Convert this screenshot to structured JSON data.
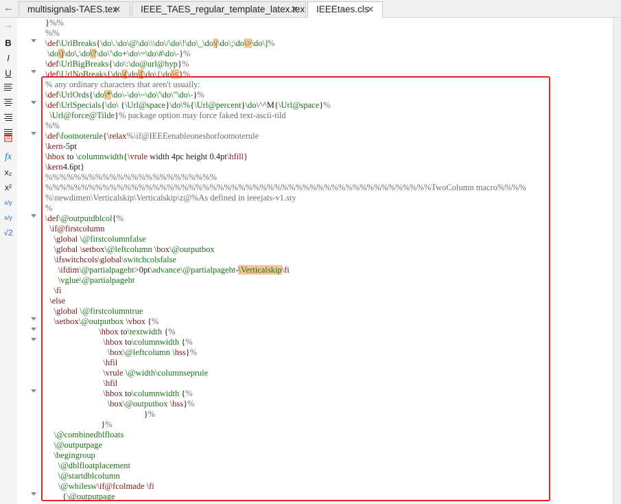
{
  "tabs": [
    {
      "label": "multisignals-TAES.tex",
      "close": "✕"
    },
    {
      "label": "IEEE_TAES_regular_template_latex.tex",
      "close": "✕"
    },
    {
      "label": "IEEEtaes.cls",
      "close": "✕",
      "active": true
    }
  ],
  "nav": {
    "back": "←",
    "forward": "→"
  },
  "toolbar": {
    "bold": "B",
    "italic": "I",
    "underline": "U",
    "fx": "fx",
    "subscript": "x₂",
    "superscript": "x²",
    "fraction": "x/y",
    "inline_fraction": "x/y",
    "sqrt": "√2",
    "icons": [
      "bold-icon",
      "italic-icon",
      "underline-icon",
      "align-left-icon",
      "align-center-icon",
      "align-right-icon",
      "align-justify-icon",
      "insert-image-icon",
      "function-icon",
      "subscript-icon",
      "superscript-icon",
      "fraction-icon",
      "inline-fraction-icon",
      "square-root-icon"
    ]
  },
  "highlight_color": "#f7c59a",
  "selection_color": "#e8201f",
  "editor_lines": [
    "}%%",
    "%%",
    "\\def\\UrlBreaks{\\do\\.\\do\\@\\do\\\\\\do\\/\\do\\!\\do\\_\\do\\|\\do\\;\\do\\>\\do\\]%",
    " \\do\\)\\do\\,\\do\\?\\do\\'\\do+\\do\\=\\do\\#\\do\\-}%",
    "\\def\\UrlBigBreaks{\\do\\:\\do@url@hyp}%",
    "\\def\\UrlNoBreaks{\\do\\(\\do\\[\\do\\{\\do\\<}%",
    "% any ordinary characters that aren't usually:",
    "\\def\\UrlOrds{\\do\\*\\do\\-\\do\\~\\do\\'\\do\\\"\\do\\-}%",
    "\\def\\UrlSpecials{\\do\\ {\\Url@space}\\do\\%{\\Url@percent}\\do\\^^M{\\Url@space}%",
    "  \\Url@force@Tilde}% package option may force faked text-ascii-tild",
    "%%",
    "\\def\\footnoterule{\\relax%\\if@IEEEenableoneshotfootnoterule",
    "\\kern-5pt",
    "\\hbox to \\columnwidth{\\vrule width 4pc height 0.4pt\\hfill}",
    "\\kern4.6pt}",
    "%%%%%%%%%%%%%%%%%%%%%%%%",
    "%%%%%%%%%%%%%%%%%%%%%%%%%%%%%%%%%%%%%%%%%%%%%%%%%%%%%%TwoColumn macro%%%%",
    "%\\newdimen\\Verticalskip\\Verticalskip\\z@%As defined in ieeejats-v1.sty",
    "%",
    "\\def\\@outputdblcol{%",
    "  \\if@firstcolumn",
    "    \\global \\@firstcolumnfalse",
    "    \\global \\setbox\\@leftcolumn \\box\\@outputbox",
    "    \\ifswitchcols\\global\\switchcolsfalse",
    "      \\ifdim\\@partialpageht>0pt\\advance\\@partialpageht-\\Verticalskip\\fi",
    "      \\vglue\\@partialpageht",
    "    \\fi",
    "  \\else",
    "    \\global \\@firstcolumntrue",
    "    \\setbox\\@outputbox \\vbox {%",
    "                         \\hbox to\\textwidth {%",
    "                           \\hbox to\\columnwidth {%",
    "                             \\box\\@leftcolumn \\hss}%",
    "                           \\hfil",
    "                           \\vrule \\@width\\columnseprule",
    "                           \\hfil",
    "                           \\hbox to\\columnwidth {%",
    "                             \\box\\@outputbox \\hss}%",
    "                                              }%",
    "                          }%",
    "    \\@combinedblfloats",
    "    \\@outputpage",
    "    \\begingroup",
    "      \\@dblfloatplacement",
    "      \\@startdblcolumn",
    "      \\@whilesw\\if@fcolmade \\fi",
    "        {\\@outputpage"
  ]
}
